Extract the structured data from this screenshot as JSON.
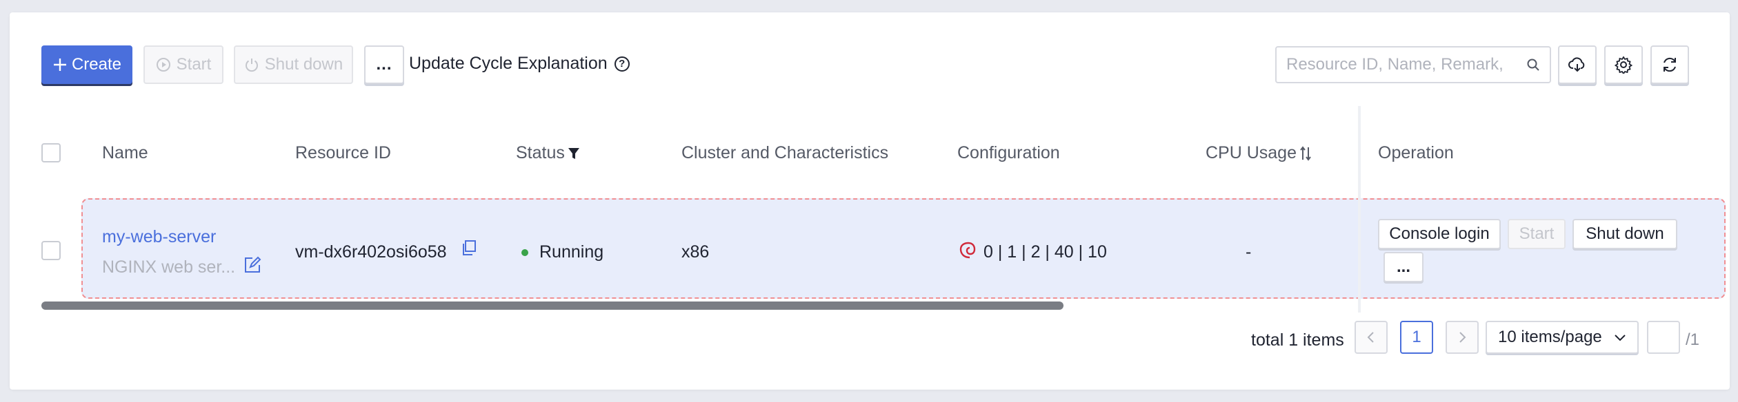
{
  "toolbar": {
    "create_label": "Create",
    "start_label": "Start",
    "shutdown_label": "Shut down",
    "more_label": "...",
    "update_cycle_label": "Update Cycle Explanation"
  },
  "search": {
    "placeholder": "Resource ID, Name, Remark,"
  },
  "table": {
    "columns": {
      "name": "Name",
      "resource_id": "Resource ID",
      "status": "Status",
      "cluster": "Cluster and Characteristics",
      "configuration": "Configuration",
      "cpu_usage": "CPU Usage",
      "operation": "Operation"
    },
    "rows": [
      {
        "name": "my-web-server",
        "remark": "NGINX web ser...",
        "resource_id": "vm-dx6r402osi6o58",
        "status": "Running",
        "cluster": "x86",
        "configuration": "0 | 1 | 2 | 40 | 10",
        "cpu_usage": "-",
        "ops": {
          "console_login": "Console login",
          "start": "Start",
          "shut_down": "Shut down",
          "more": "..."
        }
      }
    ]
  },
  "pagination": {
    "total_text": "total 1 items",
    "current_page": "1",
    "page_size": "10 items/page",
    "total_pages": "/1"
  },
  "colors": {
    "accent": "#4a6fdc",
    "running": "#3aa34a",
    "row_highlight": "#e8edfb",
    "row_border": "#f08f93"
  }
}
